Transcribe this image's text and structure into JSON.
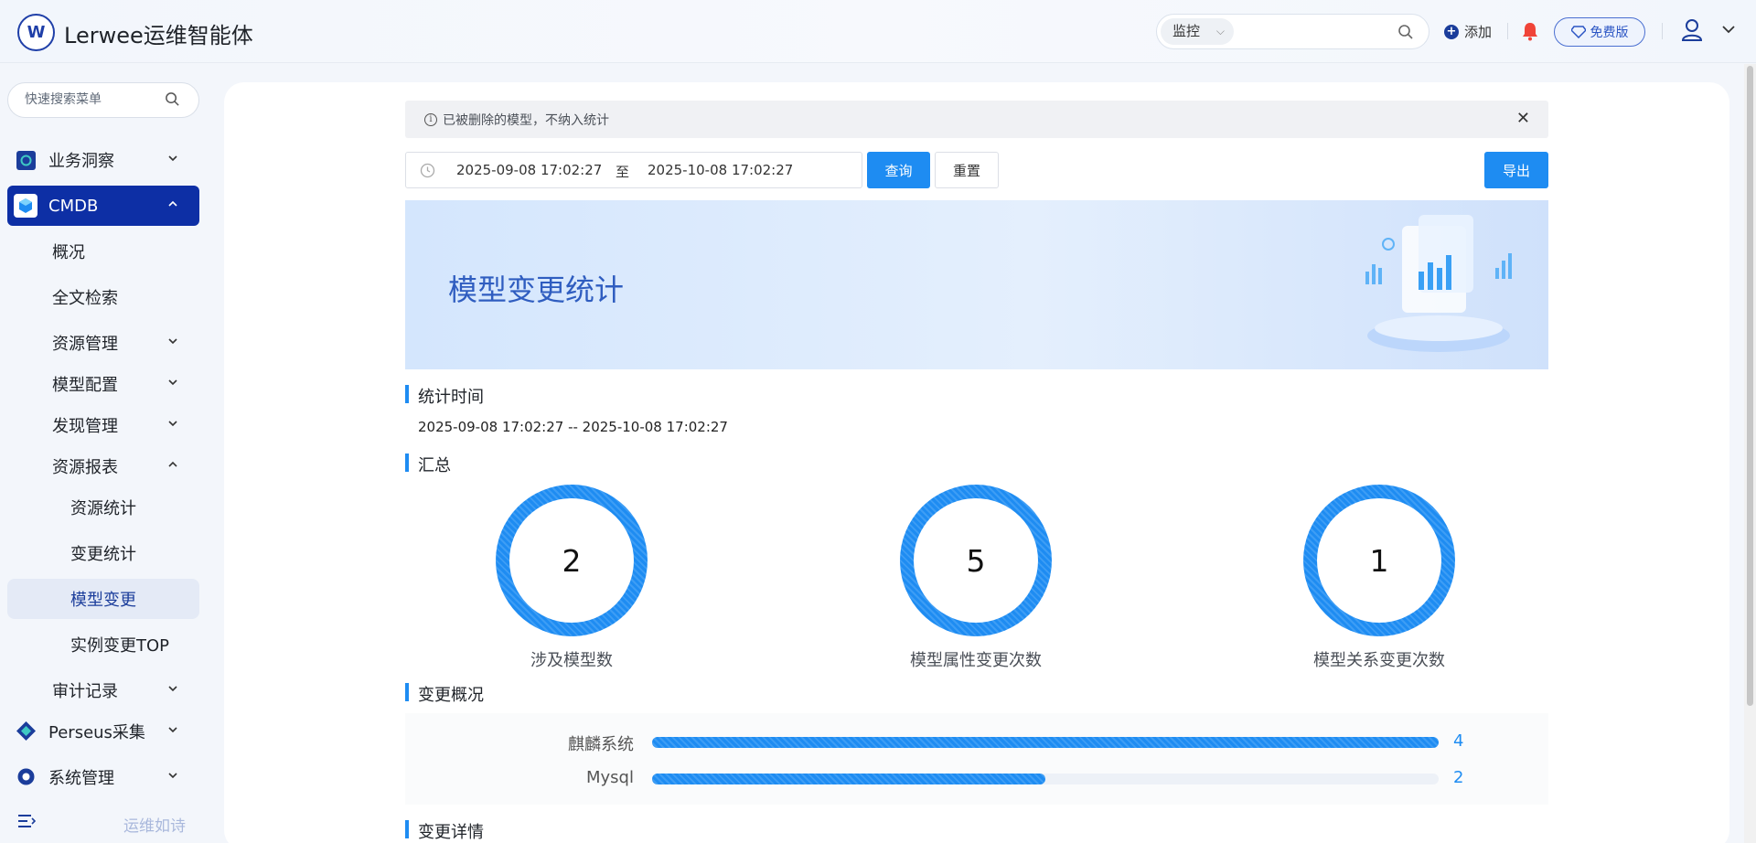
{
  "header": {
    "app_title": "Lerwee运维智能体",
    "search_scope": "监控",
    "add_label": "添加",
    "plan_label": "免费版"
  },
  "sidebar": {
    "search_placeholder": "快速搜索菜单",
    "items": [
      {
        "label": "业务洞察",
        "expanded": false
      },
      {
        "label": "CMDB",
        "expanded": true
      },
      {
        "label": "概况"
      },
      {
        "label": "全文检索"
      },
      {
        "label": "资源管理",
        "expanded": false
      },
      {
        "label": "模型配置",
        "expanded": false
      },
      {
        "label": "发现管理",
        "expanded": false
      },
      {
        "label": "资源报表",
        "expanded": true
      },
      {
        "label": "资源统计"
      },
      {
        "label": "变更统计"
      },
      {
        "label": "模型变更",
        "selected": true
      },
      {
        "label": "实例变更TOP"
      },
      {
        "label": "审计记录",
        "expanded": false
      },
      {
        "label": "Perseus采集",
        "expanded": false
      },
      {
        "label": "系统管理",
        "expanded": false
      }
    ],
    "footer_text": "运维如诗"
  },
  "main": {
    "alert_text": "已被删除的模型，不纳入统计",
    "date_start": "2025-09-08 17:02:27",
    "date_sep": "至",
    "date_end": "2025-10-08 17:02:27",
    "query_label": "查询",
    "reset_label": "重置",
    "export_label": "导出",
    "banner_title": "模型变更统计",
    "section_time": "统计时间",
    "time_range_text": "2025-09-08 17:02:27 -- 2025-10-08 17:02:27",
    "section_summary": "汇总",
    "kpis": [
      {
        "value": "2",
        "label": "涉及模型数"
      },
      {
        "value": "5",
        "label": "模型属性变更次数"
      },
      {
        "value": "1",
        "label": "模型关系变更次数"
      }
    ],
    "section_overview": "变更概况",
    "section_detail": "变更详情"
  },
  "chart_data": {
    "type": "bar",
    "orientation": "horizontal",
    "categories": [
      "麒麟系统",
      "Mysql"
    ],
    "values": [
      4,
      2
    ],
    "xlim": [
      0,
      4
    ],
    "title": "",
    "colors": {
      "bar": "#1e8cf2"
    }
  },
  "colors": {
    "accent": "#1e8cf2",
    "nav_active": "#0d2fa5"
  }
}
